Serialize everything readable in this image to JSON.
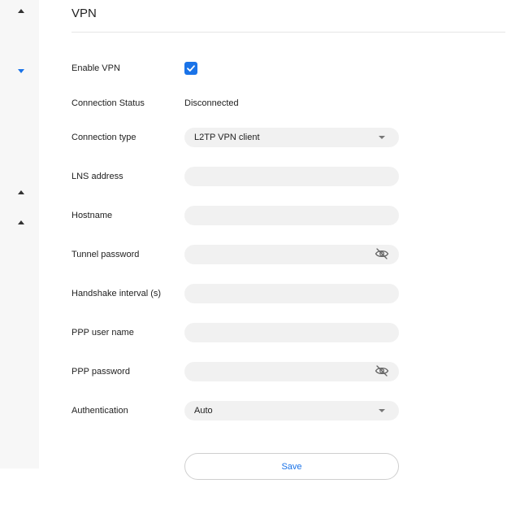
{
  "page": {
    "title": "VPN"
  },
  "colors": {
    "accent": "#1a73e8",
    "field_background": "#f1f1f1",
    "sidebar_background": "#f7f7f7"
  },
  "icons": {
    "sidebar": [
      "caret-up-icon",
      "caret-down-icon",
      "caret-up-icon",
      "caret-up-icon"
    ],
    "password_toggle": "eye-off-icon",
    "dropdown": "caret-down-icon",
    "checkbox": "checkmark-icon"
  },
  "form": {
    "enable_vpn": {
      "label": "Enable VPN",
      "checked": true
    },
    "connection_status": {
      "label": "Connection Status",
      "value": "Disconnected"
    },
    "connection_type": {
      "label": "Connection type",
      "value": "L2TP VPN client"
    },
    "lns_address": {
      "label": "LNS address",
      "value": ""
    },
    "hostname": {
      "label": "Hostname",
      "value": ""
    },
    "tunnel_password": {
      "label": "Tunnel password",
      "value": ""
    },
    "handshake_interval": {
      "label": "Handshake interval (s)",
      "value": ""
    },
    "ppp_user_name": {
      "label": "PPP user name",
      "value": ""
    },
    "ppp_password": {
      "label": "PPP password",
      "value": ""
    },
    "authentication": {
      "label": "Authentication",
      "value": "Auto"
    }
  },
  "actions": {
    "save_label": "Save"
  }
}
